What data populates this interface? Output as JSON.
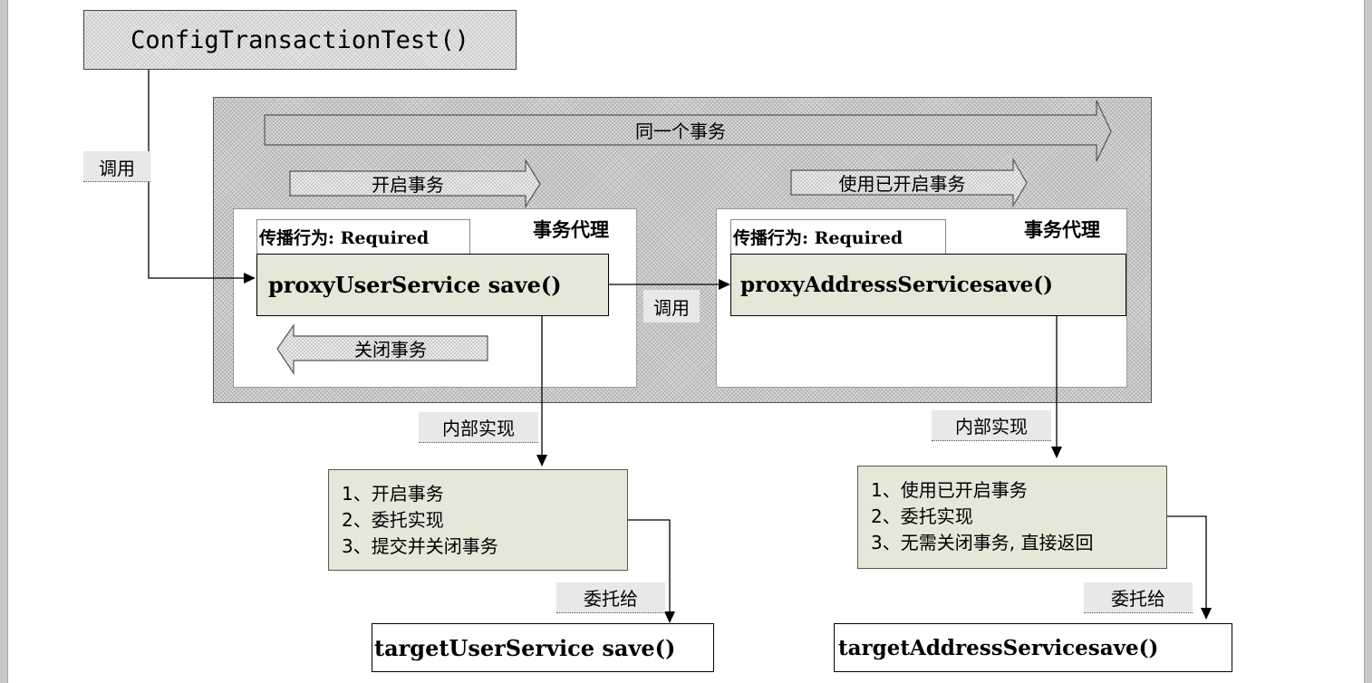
{
  "caller": {
    "label": "ConfigTransactionTest()"
  },
  "labels": {
    "call_left": "调用",
    "call_middle": "调用",
    "internal_left": "内部实现",
    "internal_right": "内部实现",
    "delegate_left": "委托给",
    "delegate_right": "委托给"
  },
  "arrows": {
    "same_transaction": "同一个事务",
    "open_transaction": "开启事务",
    "use_opened_transaction": "使用已开启事务",
    "close_transaction": "关闭事务"
  },
  "left_proxy": {
    "title": "事务代理",
    "propagation": "传播行为: Required",
    "method": "proxyUserService save()"
  },
  "right_proxy": {
    "title": "事务代理",
    "propagation": "传播行为: Required",
    "method": "proxyAddressServicesave()"
  },
  "left_steps": [
    "1、开启事务",
    "2、委托实现",
    "3、提交并关闭事务"
  ],
  "right_steps": [
    "1、使用已开启事务",
    "2、委托实现",
    "3、无需关闭事务, 直接返回"
  ],
  "left_target": {
    "method": "targetUserService save()"
  },
  "right_target": {
    "method": "targetAddressServicesave()"
  },
  "colors": {
    "box_fill": "#e4e8d8",
    "hatch": "#dcdcdc",
    "line": "#000000"
  }
}
